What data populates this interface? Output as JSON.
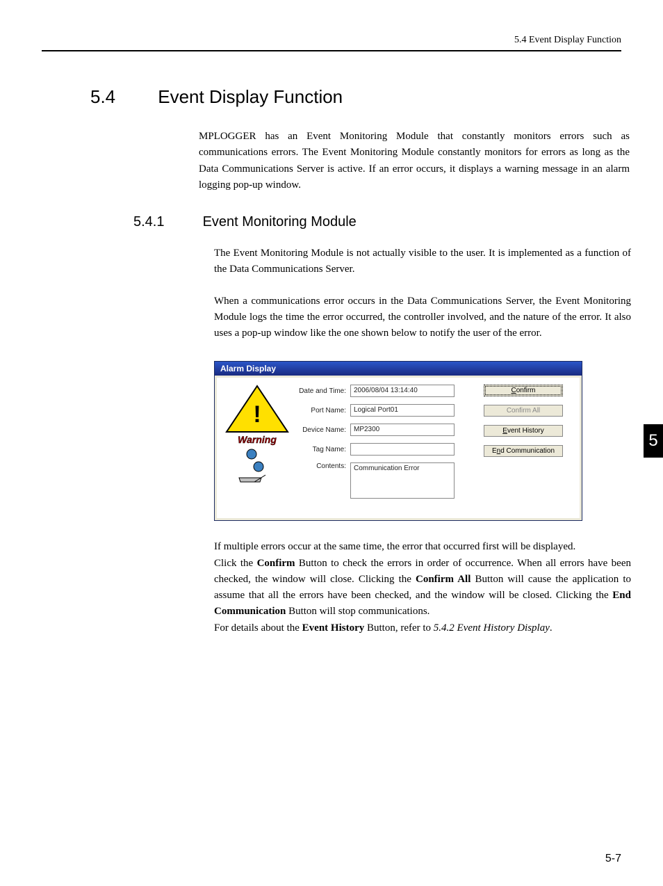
{
  "header": {
    "text": "5.4  Event Display Function"
  },
  "section": {
    "number": "5.4",
    "title": "Event Display Function"
  },
  "intro_para": "MPLOGGER has an Event Monitoring Module that constantly monitors errors such as communications errors. The Event Monitoring Module constantly monitors for errors as long as the Data Communications Server is active. If an error occurs, it displays a warning message in an alarm logging pop-up window.",
  "subsection": {
    "number": "5.4.1",
    "title": "Event Monitoring Module"
  },
  "sub_para1": "The Event Monitoring Module is not actually visible to the user. It is implemented as a function of the Data Communications Server.",
  "sub_para2": "When a communications error occurs in the Data Communications Server, the Event Monitoring Module logs the time the error occurred, the controller involved, and the nature of the error. It also uses a pop-up window like the one shown below to notify the user of the error.",
  "alarm": {
    "title": "Alarm Display",
    "fields": {
      "datetime_label": "Date and Time:",
      "datetime_value": "2006/08/04 13:14:40",
      "port_label": "Port Name:",
      "port_value": "Logical Port01",
      "device_label": "Device Name:",
      "device_value": "MP2300",
      "tag_label": "Tag Name:",
      "tag_value": "",
      "contents_label": "Contents:",
      "contents_value": "Communication Error"
    },
    "buttons": {
      "confirm": "Confirm",
      "confirm_all": "Confirm All",
      "event_history": "Event History",
      "end_comm": "End Communication"
    },
    "warning_text": "Warning"
  },
  "after1": "If multiple errors occur at the same time, the error that occurred first will be displayed.",
  "after2_pre": "Click the ",
  "after2_b1": "Confirm",
  "after2_mid1": " Button to check the errors in order of occurrence. When all errors have been checked, the window will close. Clicking the ",
  "after2_b2": "Confirm All",
  "after2_mid2": " Button will cause the application to assume that all the errors have been checked, and the window will be closed. Clicking the ",
  "after2_b3": "End Communication",
  "after2_post": " Button will stop communications.",
  "after3_pre": "For details about the ",
  "after3_b": "Event History",
  "after3_mid": " Button, refer to ",
  "after3_ref": "5.4.2  Event History Display",
  "after3_post": ".",
  "chapter_tab": "5",
  "page_number": "5-7"
}
